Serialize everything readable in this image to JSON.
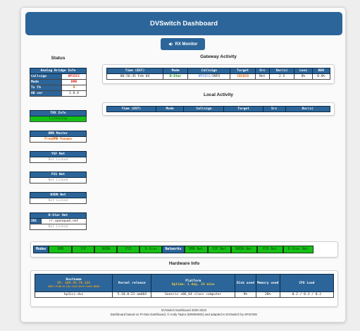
{
  "header": {
    "title": "DVSwitch Dashboard"
  },
  "rx_monitor": {
    "label": "RX Monitor",
    "icon": "speaker-icon"
  },
  "status": {
    "title": "Status",
    "analog_bridge": {
      "header": "Analog Bridge Info",
      "rows": [
        {
          "label": "Callsign",
          "value": "HP3ICC"
        },
        {
          "label": "Mode",
          "value": "DMR"
        },
        {
          "label": "Tx TG",
          "value": "9"
        },
        {
          "label": "AB ver",
          "value": "1.6.4"
        }
      ]
    },
    "trx": {
      "header": "TRX Info",
      "value": "Listening"
    },
    "dmr_master": {
      "header": "DMR Master",
      "value": "FreeDMR Panama"
    },
    "ysf": {
      "header": "YSF Net",
      "value": "Not Linked"
    },
    "p25": {
      "header": "P25 Net",
      "value": "Not Linked"
    },
    "nxdn": {
      "header": "NXDN Net",
      "value": "Not Linked"
    },
    "dstar": {
      "header": "D-Star Net",
      "irc_label": "IRC",
      "irc_value": "rr.openquad.net",
      "value": "Not Linked"
    }
  },
  "gateway": {
    "title": "Gateway Activity",
    "columns": [
      "Time (EST)",
      "Mode",
      "Callsign",
      "Target",
      "Src",
      "Dur(s)",
      "Loss",
      "BER"
    ],
    "rows": [
      {
        "time": "00:56:45 Feb 04",
        "mode": "D-Star",
        "callsign": "HP3ICC",
        "callsign_suffix": "/INFO",
        "target": "CQCQCQ",
        "src": "Net",
        "dur": "2.5",
        "loss": "0%",
        "ber": "0.0%"
      }
    ]
  },
  "local": {
    "title": "Local Activity",
    "columns": [
      "Time (EST)",
      "Mode",
      "Callsign",
      "Target",
      "Src",
      "Dur(s)"
    ]
  },
  "modes": {
    "modes_label": "Modes",
    "modes": [
      "DMR",
      "YSF",
      "NXDN",
      "P25",
      "D-Star"
    ],
    "networks_label": "Networks",
    "networks": [
      "DMR Net",
      "YSF Net",
      "NXDN Net",
      "P25 Net",
      "D-Star Net"
    ]
  },
  "hardware": {
    "title": "Hardware Info",
    "columns": {
      "hostname": "Hostname",
      "hostname_ip": "IP: 189.42.78.135",
      "hostname_ip6": "2607:f130:0:13c:218:3eff:fee5:6b80",
      "kernel": "Kernel release",
      "platform": "Platform",
      "uptime": "Uptime: 1 day, 23 mins",
      "disk": "Disk used",
      "memory": "Memory used",
      "cpu": "CPU Load"
    },
    "row": {
      "hostname": "hp3icc-dvs",
      "kernel": "5.10.0-21-amd64",
      "platform": "Generic x86_64 class computer",
      "disk": "9%",
      "memory": "20%",
      "cpu": "0.2 / 0.3 / 0.2"
    }
  },
  "footer": {
    "line1": "DVSwitch Dashboard 2020-2023",
    "line2": "Dashboard based on Pi-Star Dashboard, © Andy Taylor (MW0MWZ) and adapted to DVSwitch by SP2ONG"
  },
  "colors": {
    "accent": "#2c6599",
    "active_green": "#17c017",
    "orange": "#e06000"
  }
}
